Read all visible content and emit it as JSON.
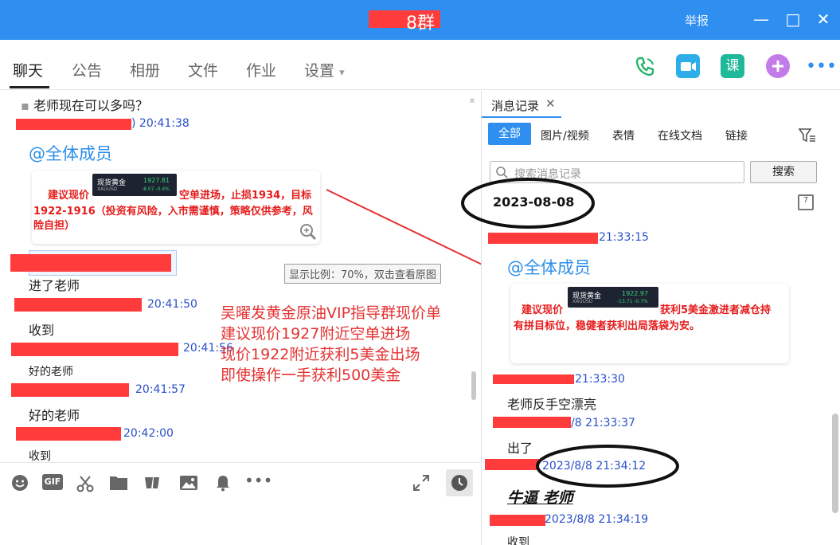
{
  "window": {
    "title": "8群",
    "report_label": "举报",
    "minimize": "—",
    "maximize": "□",
    "close": "✕"
  },
  "tabs": [
    {
      "label": "聊天"
    },
    {
      "label": "公告"
    },
    {
      "label": "相册"
    },
    {
      "label": "文件"
    },
    {
      "label": "作业"
    },
    {
      "label": "设置"
    }
  ],
  "header_icons": [
    "phone-icon",
    "video-icon",
    "lesson-icon",
    "add-app-icon",
    "more-icon"
  ],
  "lesson_label": "课",
  "chat": {
    "first_line": "老师现在可以多吗？",
    "ts1": "20:41:38",
    "mention1": "@全体成员",
    "image1": {
      "ticker_name": "现货黄金",
      "ticker_sub": "XAUUSD",
      "ticker_price": "1927.81",
      "ticker_change": "-8.07  -0.4%",
      "line1_left": "建议现价",
      "line1_right": "空单进场，止损1934，目标",
      "line2": "1922-1916（投资有风险，入市需谨慎，策略仅供参考，风",
      "line3": "险自担）"
    },
    "msg_jinle": "进了老师",
    "ts2": "20:41:50",
    "msg_shoudao": "收到",
    "ts3": "20:41:56",
    "msg_haode1": "好的老师",
    "ts4": "20:41:57",
    "msg_haode2": "好的老师",
    "ts5": "20:42:00",
    "msg_shoudao2": "收到",
    "tooltip": "显示比例：70%，双击查看原图",
    "annotation": [
      "吴曜发黄金原油VIP指导群现价单",
      "建议现价1927附近空单进场",
      "现价1922附近获利5美金出场",
      "即使操作一手获利500美金"
    ]
  },
  "toolbar": [
    "emoji-icon",
    "gif-icon",
    "scissors-icon",
    "folder-icon",
    "shake-icon",
    "image-icon",
    "bell-icon",
    "more-icon"
  ],
  "toolbar_gif": "GIF",
  "history": {
    "title": "消息记录",
    "close": "✕",
    "filters": [
      "全部",
      "图片/视频",
      "表情",
      "在线文档",
      "链接"
    ],
    "search_placeholder": "搜索消息记录",
    "search_button": "搜索",
    "date": "2023-08-08",
    "cal_label": "7",
    "ts1": "21:33:15",
    "mention": "@全体成员",
    "image": {
      "ticker_name": "现货黄金",
      "ticker_sub": "XAUUSD",
      "ticker_price": "1922.97",
      "ticker_change": "-13.71  -0.7%",
      "line1_left": "建议现价",
      "line1_right": "获利5美金激进者减仓持",
      "line2": "有拼目标位，稳健者获利出局落袋为安。"
    },
    "ts2": "21:33:30",
    "msg1": "老师反手空漂亮",
    "ts3": "/8 21:33:37",
    "msg2": "出了",
    "ts4": "2023/8/8 21:34:12",
    "msg3": "牛逼 老师",
    "ts5": "2023/8/8 21:34:19",
    "msg4": "收到"
  },
  "colors": {
    "titlebar": "#2e8ff0",
    "redaction": "#ff3b3b",
    "timestamp": "#2a4fc9",
    "mention": "#2c8fe8",
    "annotation": "#e53232"
  }
}
